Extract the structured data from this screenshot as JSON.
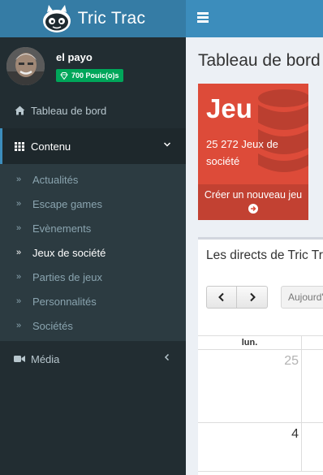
{
  "header": {
    "logo_text": "Tric Trac",
    "brand_color": "#357ca5",
    "topbar_color": "#3c8dbc"
  },
  "user": {
    "name": "el payo",
    "points": "700 Pouic(o)s"
  },
  "sidebar": {
    "dashboard_label": "Tableau de bord",
    "content_label": "Contenu",
    "content_items": [
      {
        "label": "Actualités",
        "active": false
      },
      {
        "label": "Escape games",
        "active": false
      },
      {
        "label": "Evènements",
        "active": false
      },
      {
        "label": "Jeux de société",
        "active": true
      },
      {
        "label": "Parties de jeux",
        "active": false
      },
      {
        "label": "Personnalités",
        "active": false
      },
      {
        "label": "Sociétés",
        "active": false
      }
    ],
    "media_label": "Média"
  },
  "main": {
    "title": "Tableau de bord",
    "jeu_box": {
      "title": "Jeu",
      "count": "25 272 Jeux de société",
      "footer": "Créer un nouveau jeu",
      "color": "#dd4b39"
    },
    "calendar": {
      "title": "Les directs de Tric Trac",
      "today_button": "Aujourd'hui",
      "day_header": "lun.",
      "week1_day": "25",
      "week2_day": "4"
    }
  }
}
